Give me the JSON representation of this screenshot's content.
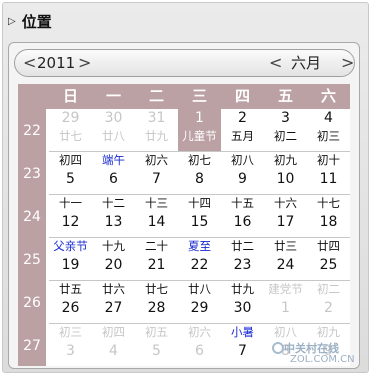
{
  "header": {
    "title": "位置"
  },
  "nav": {
    "prev_year": "<",
    "year": "2011",
    "next_year": ">",
    "prev_month": "<",
    "month": "六月",
    "next_month": ">"
  },
  "weekdays": [
    "日",
    "一",
    "二",
    "三",
    "四",
    "五",
    "六"
  ],
  "weeks": [
    "22",
    "23",
    "24",
    "25",
    "26",
    "27"
  ],
  "days": [
    [
      {
        "solar": "29",
        "lunar": "廿七",
        "grey": true
      },
      {
        "solar": "30",
        "lunar": "廿八",
        "grey": true
      },
      {
        "solar": "31",
        "lunar": "廿九",
        "grey": true
      },
      {
        "solar": "1",
        "lunar": "儿童节",
        "selected": true
      },
      {
        "solar": "2",
        "lunar": "五月"
      },
      {
        "solar": "3",
        "lunar": "初二"
      },
      {
        "solar": "4",
        "lunar": "初三"
      }
    ],
    [
      {
        "solar": "5",
        "lunar": "初四"
      },
      {
        "solar": "6",
        "lunar": "端午",
        "festival": true
      },
      {
        "solar": "7",
        "lunar": "初六"
      },
      {
        "solar": "8",
        "lunar": "初七"
      },
      {
        "solar": "9",
        "lunar": "初八"
      },
      {
        "solar": "10",
        "lunar": "初九"
      },
      {
        "solar": "11",
        "lunar": "初十"
      }
    ],
    [
      {
        "solar": "12",
        "lunar": "十一"
      },
      {
        "solar": "13",
        "lunar": "十二"
      },
      {
        "solar": "14",
        "lunar": "十三"
      },
      {
        "solar": "15",
        "lunar": "十四"
      },
      {
        "solar": "16",
        "lunar": "十五"
      },
      {
        "solar": "17",
        "lunar": "十六"
      },
      {
        "solar": "18",
        "lunar": "十七"
      }
    ],
    [
      {
        "solar": "19",
        "lunar": "父亲节",
        "festival": true
      },
      {
        "solar": "20",
        "lunar": "十九"
      },
      {
        "solar": "21",
        "lunar": "二十"
      },
      {
        "solar": "22",
        "lunar": "夏至",
        "festival": true
      },
      {
        "solar": "23",
        "lunar": "廿二"
      },
      {
        "solar": "24",
        "lunar": "廿三"
      },
      {
        "solar": "25",
        "lunar": "廿四"
      }
    ],
    [
      {
        "solar": "26",
        "lunar": "廿五"
      },
      {
        "solar": "27",
        "lunar": "廿六"
      },
      {
        "solar": "28",
        "lunar": "廿七"
      },
      {
        "solar": "29",
        "lunar": "廿八"
      },
      {
        "solar": "30",
        "lunar": "廿九"
      },
      {
        "solar": "1",
        "lunar": "建党节",
        "grey": true
      },
      {
        "solar": "2",
        "lunar": "初二",
        "grey": true
      }
    ],
    [
      {
        "solar": "3",
        "lunar": "初三",
        "grey": true
      },
      {
        "solar": "4",
        "lunar": "初四",
        "grey": true
      },
      {
        "solar": "5",
        "lunar": "初五",
        "grey": true
      },
      {
        "solar": "6",
        "lunar": "初六",
        "grey": true
      },
      {
        "solar": "7",
        "lunar": "小暑",
        "festival": true
      },
      {
        "solar": "8",
        "lunar": "初八",
        "grey": true
      },
      {
        "solar": "9",
        "lunar": "初九",
        "grey": true
      }
    ]
  ],
  "watermark": {
    "text": "中关村在线",
    "url": "ZOL.COM.CN"
  },
  "colors": {
    "header_bg": "#bba0a4",
    "festival": "#1b2bd1",
    "grey_day": "#c6c6c6"
  }
}
